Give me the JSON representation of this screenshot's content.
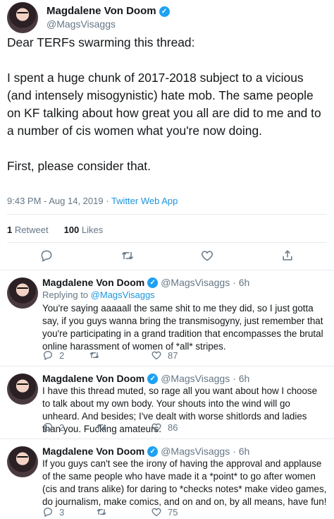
{
  "main": {
    "author": {
      "name": "Magdalene Von Doom",
      "handle": "@MagsVisaggs"
    },
    "paragraphs": [
      "Dear TERFs swarming this thread:",
      "I spent a huge chunk of 2017-2018 subject to a vicious (and intensely misogynistic) hate mob. The same people on KF talking about how great you all are did to me and to a number of cis women what you're now doing.",
      "First, please consider that."
    ],
    "timestamp": "9:43 PM - Aug 14, 2019",
    "separator": " · ",
    "app": "Twitter Web App",
    "retweets_count": "1",
    "retweets_label": "Retweet",
    "likes_count": "100",
    "likes_label": "Likes"
  },
  "replies": [
    {
      "name": "Magdalene Von Doom",
      "handle": "@MagsVisaggs",
      "time": "· 6h",
      "replying_label": "Replying to",
      "replying_to": "@MagsVisaggs",
      "text": "You're saying aaaaall the same shit to me they did, so I just gotta say, if you guys wanna bring the transmisogyny, just remember that you're participating in a grand tradition that encompasses the brutal online harassment of women of *all* stripes.",
      "reply_count": "2",
      "retweet_count": "",
      "like_count": "87"
    },
    {
      "name": "Magdalene Von Doom",
      "handle": "@MagsVisaggs",
      "time": "· 6h",
      "text": "I have this thread muted, so rage all you want about how I choose to talk about my own body. Your shouts into the wind will go unheard. And besides; I've dealt with worse shitlords and ladies than you. Fucking amateurs.",
      "reply_count": "2",
      "retweet_count": "",
      "like_count": "86"
    },
    {
      "name": "Magdalene Von Doom",
      "handle": "@MagsVisaggs",
      "time": "· 6h",
      "text": "If you guys can't see the irony of having the approval and applause of the same people who have made it a *point* to go after women (cis and trans alike) for daring to *checks notes* make video games, do journalism, make comics, and on and on, by all means, have fun!",
      "reply_count": "3",
      "retweet_count": "",
      "like_count": "75"
    }
  ],
  "icons": {
    "verified": "verified-badge-icon",
    "reply": "reply-icon",
    "retweet": "retweet-icon",
    "like": "heart-icon",
    "share": "share-icon"
  },
  "colors": {
    "accent": "#1da1f2",
    "link": "#1b95e0",
    "muted": "#657786",
    "text": "#14171a"
  }
}
